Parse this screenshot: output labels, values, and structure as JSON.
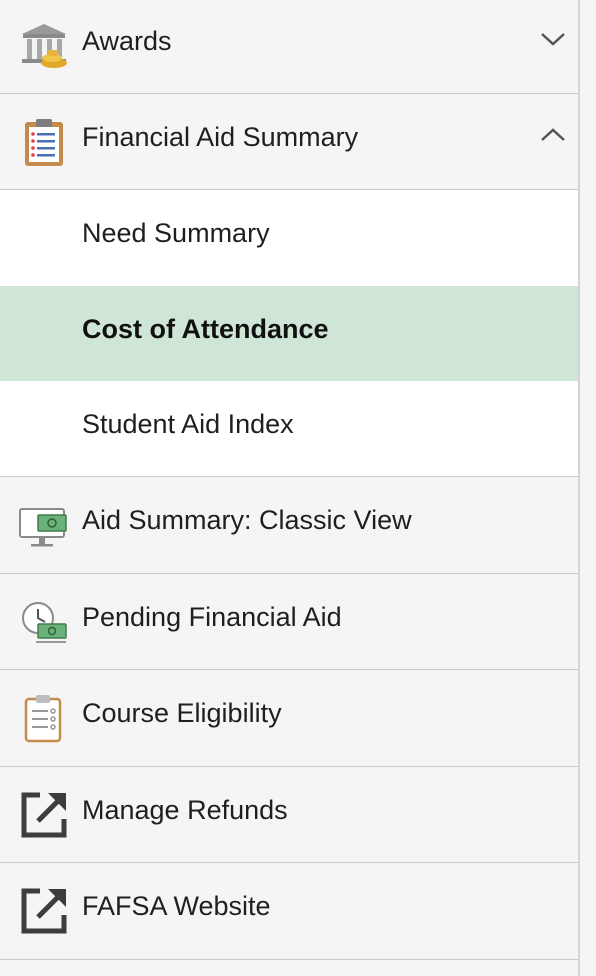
{
  "menu": {
    "awards": {
      "label": "Awards",
      "icon": "bank-coins-icon",
      "state": "collapsed"
    },
    "financial_aid_summary": {
      "label": "Financial Aid Summary",
      "icon": "clipboard-list-icon",
      "state": "expanded",
      "children": [
        {
          "label": "Need Summary"
        },
        {
          "label": "Cost of Attendance",
          "selected": true
        },
        {
          "label": "Student Aid Index"
        }
      ]
    },
    "aid_summary_classic": {
      "label": "Aid Summary: Classic View",
      "icon": "monitor-cash-icon"
    },
    "pending_aid": {
      "label": "Pending Financial Aid",
      "icon": "clock-cash-icon"
    },
    "course_eligibility": {
      "label": "Course Eligibility",
      "icon": "clipboard-check-icon"
    },
    "manage_refunds": {
      "label": "Manage Refunds",
      "icon": "external-link-icon"
    },
    "fafsa": {
      "label": "FAFSA Website",
      "icon": "external-link-icon"
    }
  },
  "colors": {
    "selected_bg": "#cfe6d6",
    "divider": "#c9c9c9",
    "text": "#1f1f1f"
  }
}
